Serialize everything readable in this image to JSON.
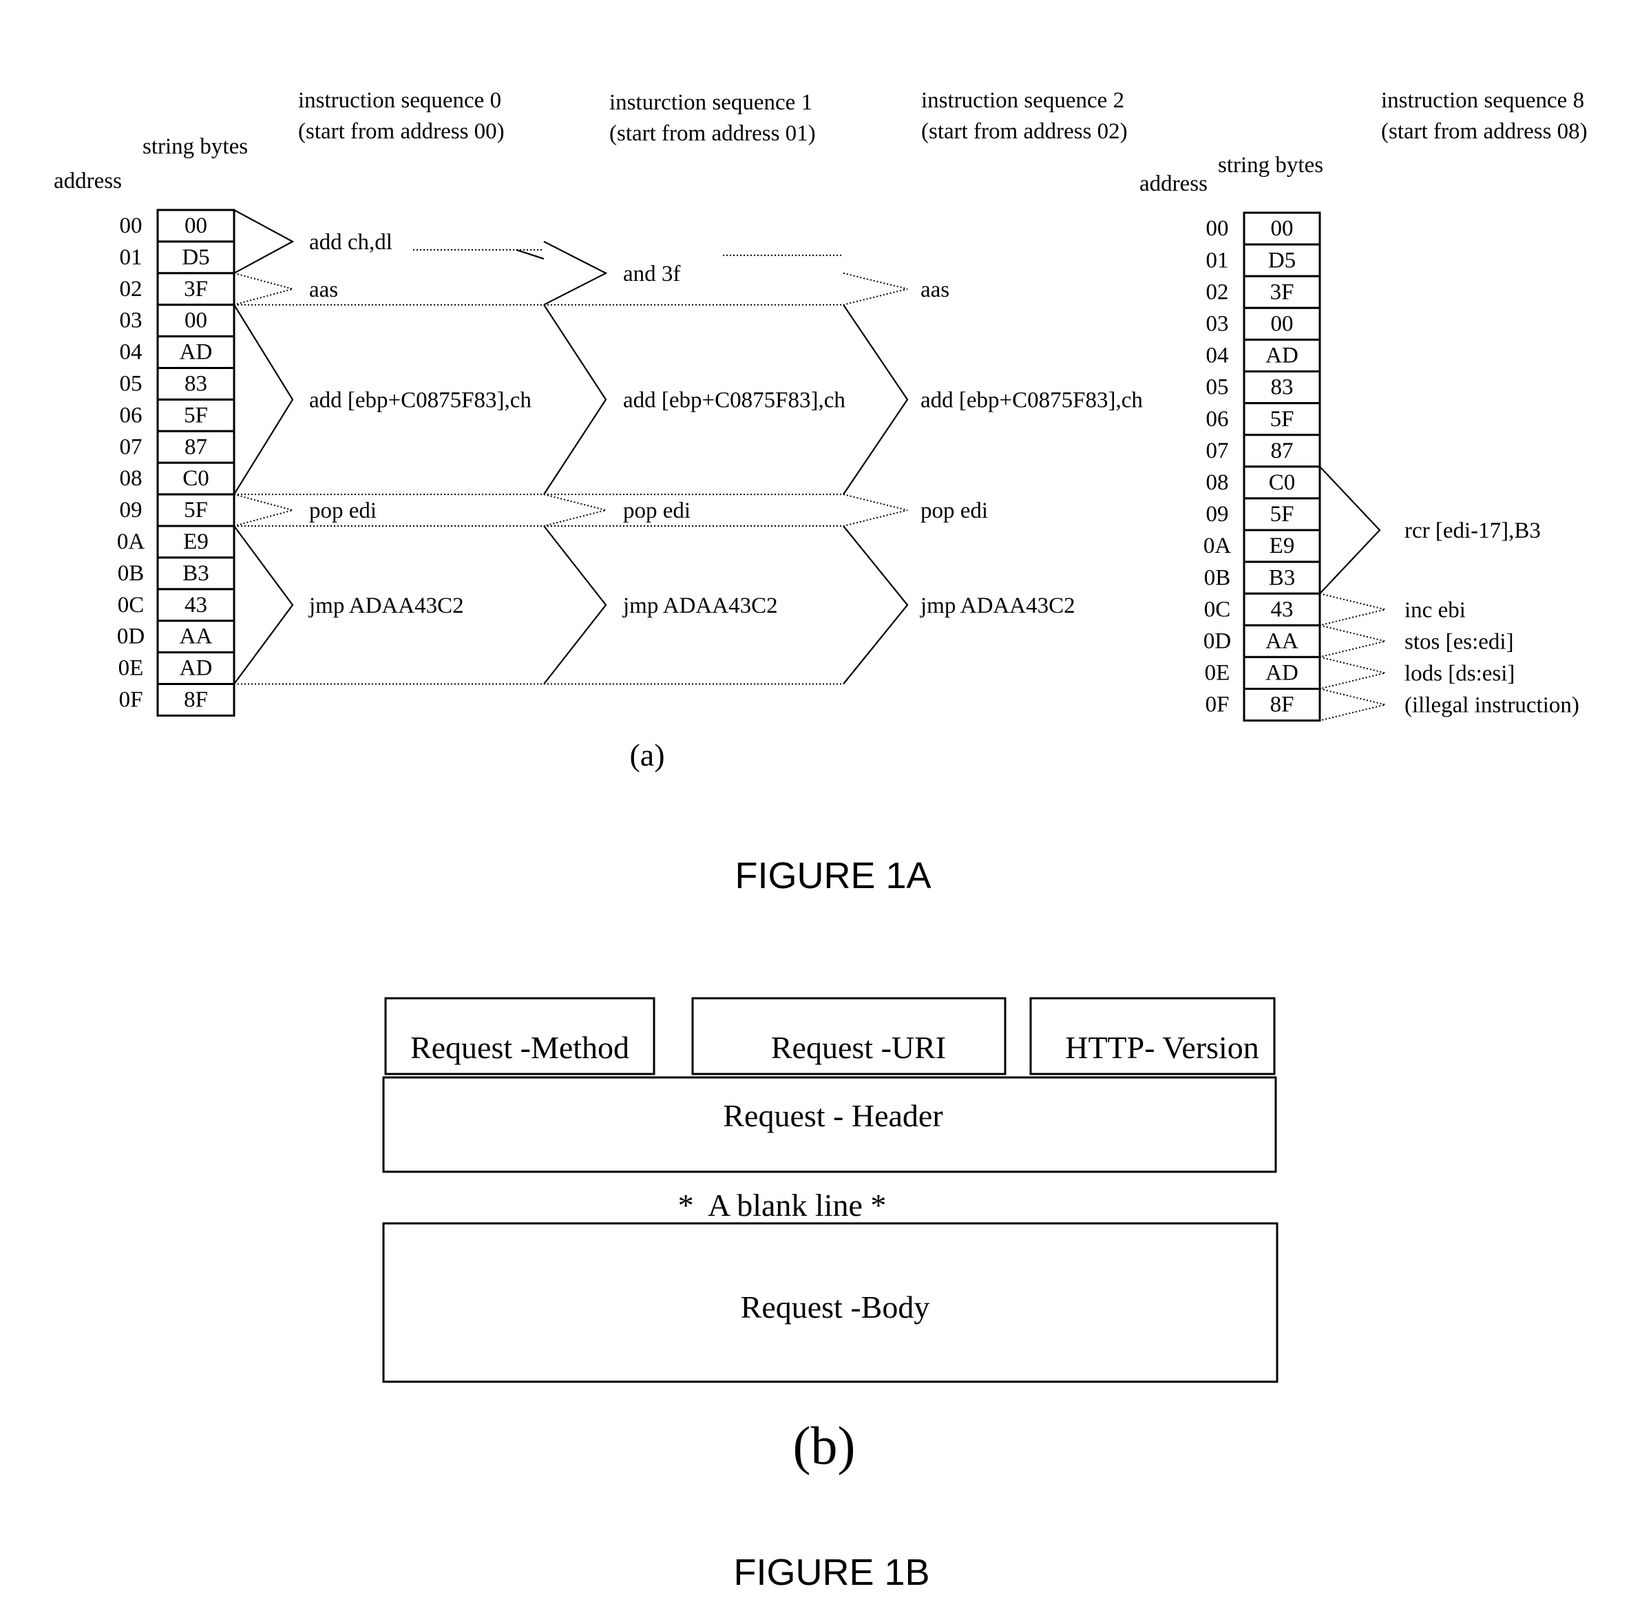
{
  "figure_1a": {
    "panel_label": "(a)",
    "caption": "FIGURE 1A",
    "left_table": {
      "address_header": "address",
      "bytes_header": "string bytes",
      "rows": [
        {
          "address": "00",
          "byte": "00"
        },
        {
          "address": "01",
          "byte": "D5"
        },
        {
          "address": "02",
          "byte": "3F"
        },
        {
          "address": "03",
          "byte": "00"
        },
        {
          "address": "04",
          "byte": "AD"
        },
        {
          "address": "05",
          "byte": "83"
        },
        {
          "address": "06",
          "byte": "5F"
        },
        {
          "address": "07",
          "byte": "87"
        },
        {
          "address": "08",
          "byte": "C0"
        },
        {
          "address": "09",
          "byte": "5F"
        },
        {
          "address": "0A",
          "byte": "E9"
        },
        {
          "address": "0B",
          "byte": "B3"
        },
        {
          "address": "0C",
          "byte": "43"
        },
        {
          "address": "0D",
          "byte": "AA"
        },
        {
          "address": "0E",
          "byte": "AD"
        },
        {
          "address": "0F",
          "byte": "8F"
        }
      ]
    },
    "sequences": [
      {
        "title": "instruction sequence 0",
        "subtitle": "(start from address 00)",
        "instructions": [
          {
            "text": "add ch,dl",
            "from": 0,
            "to": 1
          },
          {
            "text": "aas",
            "from": 2,
            "to": 2
          },
          {
            "text": "add [ebp+C0875F83],ch",
            "from": 3,
            "to": 8
          },
          {
            "text": "pop edi",
            "from": 9,
            "to": 9
          },
          {
            "text": "jmp ADAA43C2",
            "from": 10,
            "to": 14
          }
        ]
      },
      {
        "title": "insturction sequence 1",
        "subtitle": "(start from address 01)",
        "instructions": [
          {
            "text": "and 3f",
            "from": 1,
            "to": 2
          },
          {
            "text": "add [ebp+C0875F83],ch",
            "from": 3,
            "to": 8
          },
          {
            "text": "pop edi",
            "from": 9,
            "to": 9
          },
          {
            "text": "jmp ADAA43C2",
            "from": 10,
            "to": 14
          }
        ]
      },
      {
        "title": "instruction sequence 2",
        "subtitle": "(start from address 02)",
        "instructions": [
          {
            "text": "aas",
            "from": 2,
            "to": 2
          },
          {
            "text": "add [ebp+C0875F83],ch",
            "from": 3,
            "to": 8
          },
          {
            "text": "pop edi",
            "from": 9,
            "to": 9
          },
          {
            "text": "jmp ADAA43C2",
            "from": 10,
            "to": 14
          }
        ]
      }
    ],
    "right_table": {
      "address_header": "address",
      "bytes_header": "string bytes",
      "rows": [
        {
          "address": "00",
          "byte": "00"
        },
        {
          "address": "01",
          "byte": "D5"
        },
        {
          "address": "02",
          "byte": "3F"
        },
        {
          "address": "03",
          "byte": "00"
        },
        {
          "address": "04",
          "byte": "AD"
        },
        {
          "address": "05",
          "byte": "83"
        },
        {
          "address": "06",
          "byte": "5F"
        },
        {
          "address": "07",
          "byte": "87"
        },
        {
          "address": "08",
          "byte": "C0"
        },
        {
          "address": "09",
          "byte": "5F"
        },
        {
          "address": "0A",
          "byte": "E9"
        },
        {
          "address": "0B",
          "byte": "B3"
        },
        {
          "address": "0C",
          "byte": "43"
        },
        {
          "address": "0D",
          "byte": "AA"
        },
        {
          "address": "0E",
          "byte": "AD"
        },
        {
          "address": "0F",
          "byte": "8F"
        }
      ]
    },
    "sequence_8": {
      "title": "instruction sequence 8",
      "subtitle": "(start from address 08)",
      "instructions": [
        {
          "text": "rcr [edi-17],B3",
          "from": 8,
          "to": 11
        },
        {
          "text": "inc ebi",
          "from": 12,
          "to": 12
        },
        {
          "text": "stos [es:edi]",
          "from": 13,
          "to": 13
        },
        {
          "text": "lods [ds:esi]",
          "from": 14,
          "to": 14
        },
        {
          "text": "(illegal instruction)",
          "from": 15,
          "to": 15
        }
      ]
    }
  },
  "figure_1b": {
    "panel_label": "(b)",
    "caption": "FIGURE 1B",
    "request_line": {
      "method": "Request -Method",
      "uri": "Request -URI",
      "version": "HTTP- Version"
    },
    "header": "Request - Header",
    "blank_line": "*  A blank line *",
    "body": "Request -Body"
  }
}
